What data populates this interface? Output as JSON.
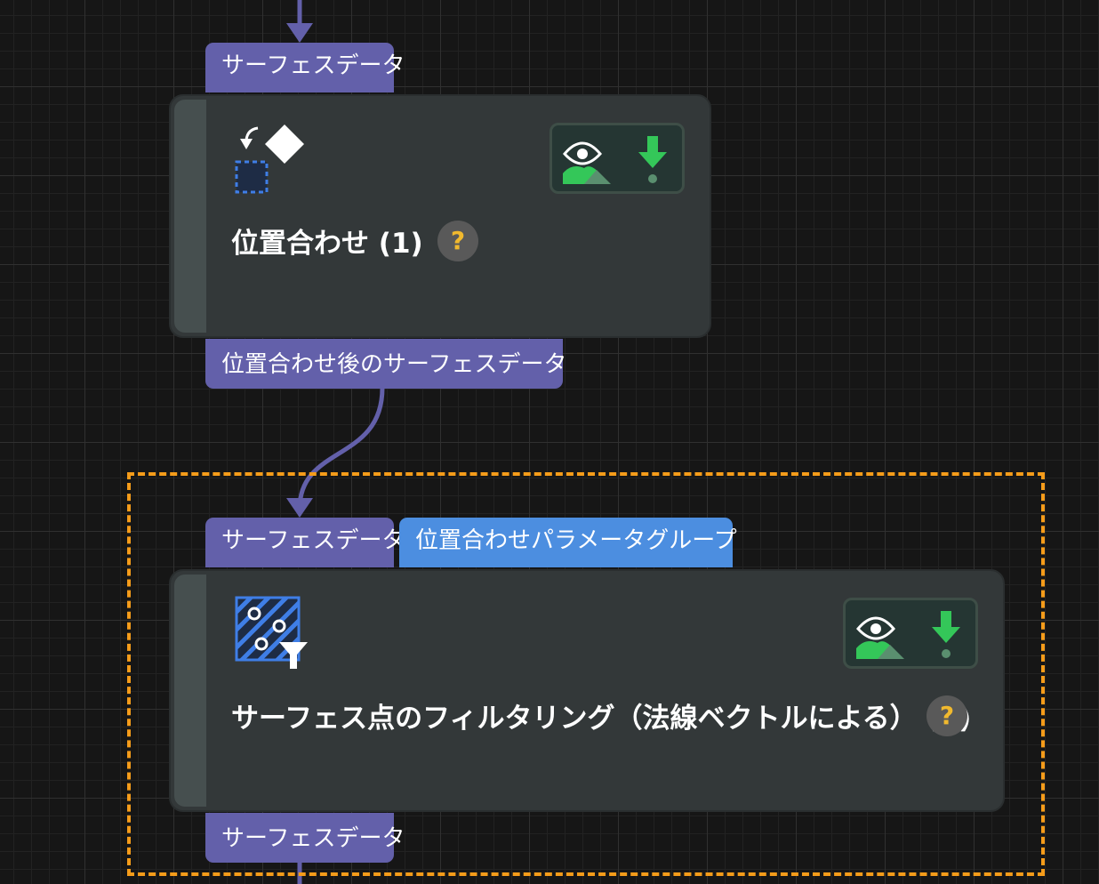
{
  "node1": {
    "title": "位置合わせ (1)",
    "input_port": "サーフェスデータ",
    "output_port": "位置合わせ後のサーフェスデータ",
    "help": "?",
    "icon": "alignment-icon"
  },
  "node2": {
    "title": "サーフェス点のフィルタリング（法線ベクトルによる） (1)",
    "input_port": "サーフェスデータ",
    "param_port": "位置合わせパラメータグループ",
    "output_port": "サーフェスデータ",
    "help": "?",
    "icon": "point-filter-icon"
  },
  "colors": {
    "port": "#6360aa",
    "param_port": "#4c8ee0",
    "node": "#333839",
    "selection": "#f59c1a",
    "help_mark": "#f1b92e",
    "save_icon": "#34c759"
  }
}
